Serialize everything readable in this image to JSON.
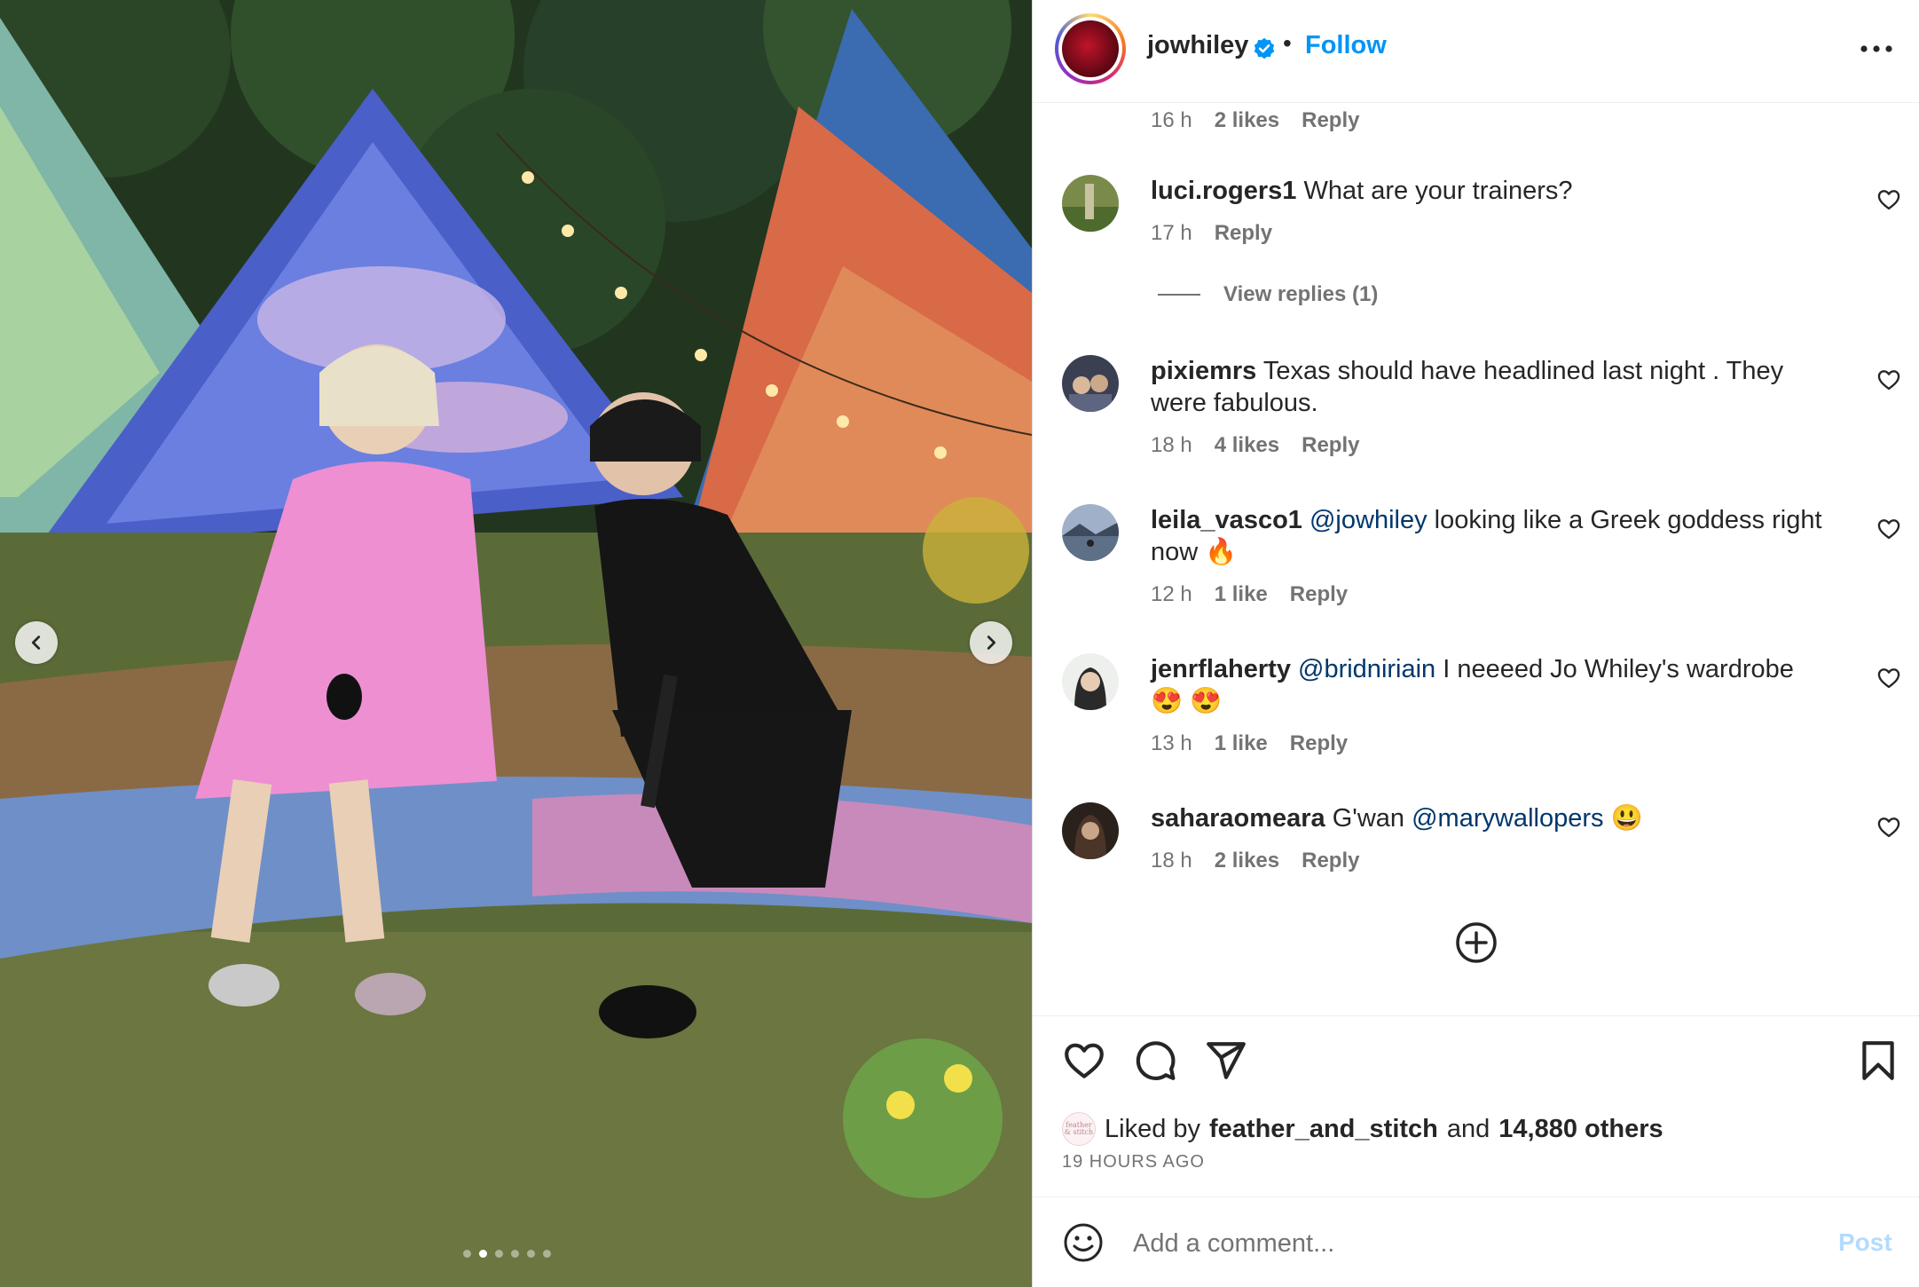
{
  "post": {
    "username": "jowhiley",
    "separator": "•",
    "follow_label": "Follow"
  },
  "carousel": {
    "slide_count": 6,
    "active_index": 1
  },
  "top_meta": {
    "time": "16 h",
    "likes": "2 likes",
    "reply": "Reply"
  },
  "comments": [
    {
      "user": "luci.rogers1",
      "parts": [
        {
          "text": "What are your trainers?"
        }
      ],
      "time": "17 h",
      "likes": "",
      "reply": "Reply",
      "view_replies": "View replies (1)"
    },
    {
      "user": "pixiemrs",
      "parts": [
        {
          "text": "Texas should have headlined last night . They were fabulous."
        }
      ],
      "time": "18 h",
      "likes": "4 likes",
      "reply": "Reply"
    },
    {
      "user": "leila_vasco1",
      "parts": [
        {
          "text": "@jowhiley",
          "mention": true
        },
        {
          "text": " looking like a Greek goddess right now 🔥"
        }
      ],
      "time": "12 h",
      "likes": "1 like",
      "reply": "Reply"
    },
    {
      "user": "jenrflaherty",
      "parts": [
        {
          "text": "@bridniriain",
          "mention": true
        },
        {
          "text": " I neeeed Jo Whiley's wardrobe 😍 😍"
        }
      ],
      "time": "13 h",
      "likes": "1 like",
      "reply": "Reply"
    },
    {
      "user": "saharaomeara",
      "parts": [
        {
          "text": "G'wan "
        },
        {
          "text": "@marywallopers",
          "mention": true
        },
        {
          "text": " 😃"
        }
      ],
      "time": "18 h",
      "likes": "2 likes",
      "reply": "Reply"
    }
  ],
  "likes_summary": {
    "prefix": "Liked by",
    "user": "feather_and_stitch",
    "conj": "and",
    "others": "14,880 others",
    "avatar_text": "feather & stitch"
  },
  "timestamp": "19 HOURS AGO",
  "add_comment": {
    "placeholder": "Add a comment...",
    "post_label": "Post"
  },
  "colors": {
    "link": "#0095f6",
    "mention": "#00376b",
    "muted": "#737373",
    "post_disabled": "#b3dbff"
  },
  "icons": {
    "more": "more-horizontal-icon",
    "like": "heart-icon",
    "comment": "comment-icon",
    "share": "send-icon",
    "save": "bookmark-icon",
    "add": "plus-circle-icon",
    "emoji": "smiley-icon",
    "verified": "verified-badge-icon"
  }
}
